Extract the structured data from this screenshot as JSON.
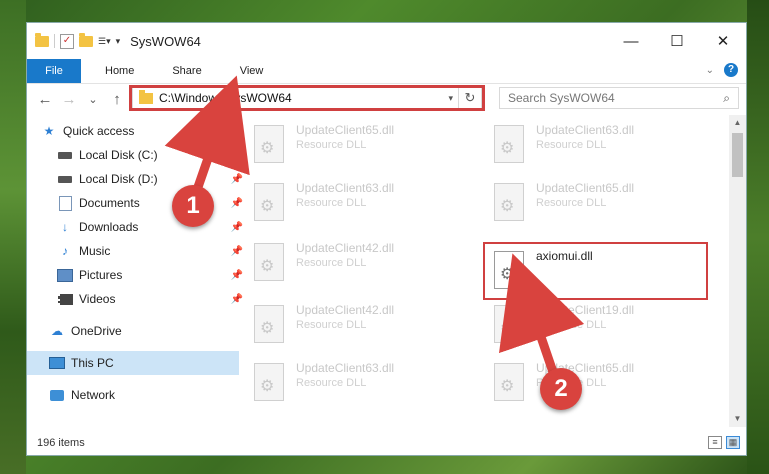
{
  "window": {
    "title": "SysWOW64",
    "controls": {
      "minimize": "—",
      "maximize": "☐",
      "close": "✕"
    }
  },
  "ribbon": {
    "file_tab": "File",
    "tabs": [
      "Home",
      "Share",
      "View"
    ],
    "expand_icon": "chevron-down-icon",
    "help_label": "?"
  },
  "nav": {
    "back": "←",
    "forward": "→",
    "recent": "⌄",
    "up": "↑",
    "address": "C:\\Windows\\SysWOW64",
    "refresh": "↻",
    "search_placeholder": "Search SysWOW64"
  },
  "sidebar": {
    "items": [
      {
        "label": "Quick access",
        "icon": "star-icon",
        "pinned": false
      },
      {
        "label": "Local Disk (C:)",
        "icon": "drive-icon",
        "pinned": true
      },
      {
        "label": "Local Disk (D:)",
        "icon": "drive-icon",
        "pinned": true
      },
      {
        "label": "Documents",
        "icon": "documents-icon",
        "pinned": true
      },
      {
        "label": "Downloads",
        "icon": "download-icon",
        "pinned": true
      },
      {
        "label": "Music",
        "icon": "music-icon",
        "pinned": true
      },
      {
        "label": "Pictures",
        "icon": "pictures-icon",
        "pinned": true
      },
      {
        "label": "Videos",
        "icon": "videos-icon",
        "pinned": true
      },
      {
        "label": "OneDrive",
        "icon": "cloud-icon",
        "pinned": false
      },
      {
        "label": "This PC",
        "icon": "computer-icon",
        "pinned": false,
        "selected": true
      },
      {
        "label": "Network",
        "icon": "network-icon",
        "pinned": false
      }
    ]
  },
  "files": [
    {
      "name": "UpdateClient65.dll",
      "desc": "Resource DLL"
    },
    {
      "name": "UpdateClient63.dll",
      "desc": "Resource DLL"
    },
    {
      "name": "UpdateClient63.dll",
      "desc": "Resource DLL"
    },
    {
      "name": "UpdateClient65.dll",
      "desc": "Resource DLL"
    },
    {
      "name": "UpdateClient42.dll",
      "desc": "Resource DLL"
    },
    {
      "name": "axiomui.dll",
      "desc": ""
    },
    {
      "name": "UpdateClient42.dll",
      "desc": "Resource DLL"
    },
    {
      "name": "UpdateClient19.dll",
      "desc": "Resource DLL"
    },
    {
      "name": "UpdateClient63.dll",
      "desc": "Resource DLL"
    },
    {
      "name": "UpdateClient65.dll",
      "desc": "Resource DLL"
    }
  ],
  "status": {
    "item_count": "196 items"
  },
  "annotations": {
    "step1": "1",
    "step2": "2",
    "color": "#d9433e"
  }
}
